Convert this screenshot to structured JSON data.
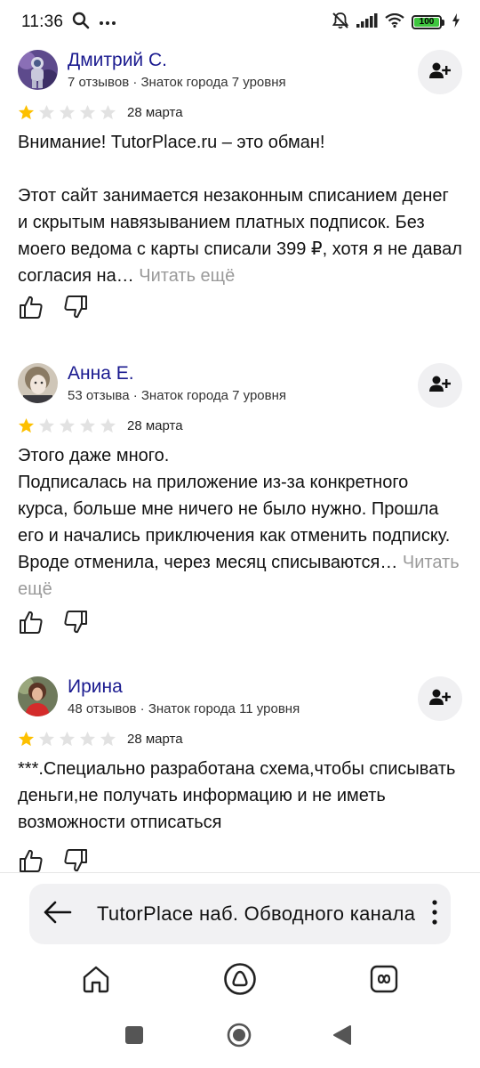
{
  "status_bar": {
    "time": "11:36",
    "battery": "100"
  },
  "reviews": [
    {
      "name": "Дмитрий С.",
      "meta": "7 отзывов · Знаток города 7 уровня",
      "rating": 1,
      "date": "28 марта",
      "text": "Внимание! TutorPlace.ru – это обман!\n\nЭтот сайт занимается незаконным списанием денег и скрытым навязыванием платных подписок. Без моего ведома с карты списали 399 ₽, хотя я не давал согласия на… ",
      "read_more": "Читать ещё"
    },
    {
      "name": "Анна Е.",
      "meta": "53 отзыва · Знаток города 7 уровня",
      "rating": 1,
      "date": "28 марта",
      "text": "Этого даже много.\nПодписалась на приложение из-за конкретного курса, больше мне ничего не было нужно. Прошла его и начались приключения как отменить подписку. Вроде отменила, через месяц списываются… ",
      "read_more": "Читать ещё"
    },
    {
      "name": "Ирина",
      "meta": "48 отзывов · Знаток города 11 уровня",
      "rating": 1,
      "date": "28 марта",
      "text": "***.Специально разработана схема,чтобы списывать деньги,не получать информацию и не иметь возможности отписаться",
      "read_more": ""
    }
  ],
  "address_bar": {
    "url": "TutorPlace наб. Обводного канала"
  },
  "colors": {
    "name_color": "#1a1a8f",
    "star_filled": "#fdc000",
    "star_empty": "#e2e2e2",
    "address_bg": "#f1f1f3"
  },
  "icons": {
    "status": [
      "search-icon",
      "more-dots-icon",
      "mute-icon",
      "signal-icon",
      "wifi-icon",
      "battery-icon",
      "charging-icon"
    ],
    "review": [
      "add-friend-icon",
      "star-icon",
      "thumb-up-icon",
      "thumb-down-icon"
    ],
    "address_bar": [
      "back-arrow-icon",
      "kebab-menu-icon"
    ],
    "app_nav": [
      "home-icon",
      "alice-icon",
      "tabs-icon"
    ],
    "system_nav": [
      "recents-icon",
      "home-circle-icon",
      "back-triangle-icon"
    ]
  }
}
